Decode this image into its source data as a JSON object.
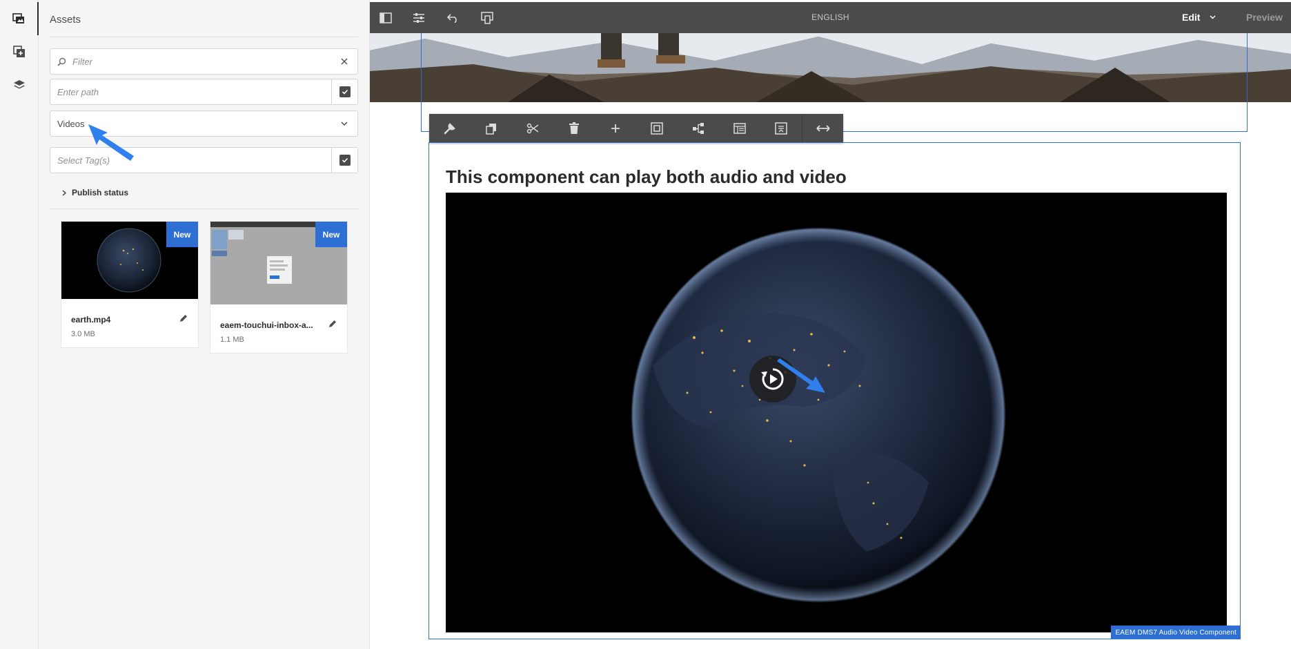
{
  "rail": {
    "items": [
      {
        "icon": "assets-icon",
        "active": true
      },
      {
        "icon": "components-icon",
        "active": false
      },
      {
        "icon": "layers-icon",
        "active": false
      }
    ]
  },
  "panel": {
    "title": "Assets",
    "filter_placeholder": "Filter",
    "path_placeholder": "Enter path",
    "asset_type": "Videos",
    "tags_placeholder": "Select Tag(s)",
    "publish_status_label": "Publish status",
    "assets": [
      {
        "name": "earth.mp4",
        "size": "3.0 MB",
        "badge": "New"
      },
      {
        "name": "eaem-touchui-inbox-a...",
        "size": "1.1 MB",
        "badge": "New"
      }
    ]
  },
  "editor": {
    "language": "ENGLISH",
    "mode": "Edit",
    "preview_label": "Preview",
    "component_title": "This component can play both audio and video",
    "component_label": "EAEM DMS7 Audio Video Component",
    "toolbar_icons": [
      "configure-icon",
      "copy-icon",
      "cut-icon",
      "delete-icon",
      "insert-icon",
      "layout-icon",
      "parent-icon",
      "edit-template-icon",
      "group-icon",
      "resize-icon"
    ]
  },
  "colors": {
    "accent": "#2d6fd3",
    "topbar": "#4b4b4b",
    "panel_bg": "#f5f5f5"
  }
}
